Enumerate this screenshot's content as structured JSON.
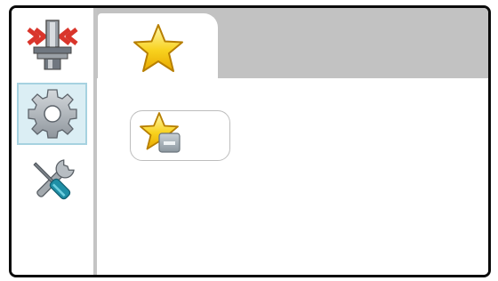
{
  "window": {
    "title": ""
  },
  "sidebar": {
    "items": [
      {
        "icon": "compress-tool-icon",
        "active": false
      },
      {
        "icon": "gear-icon",
        "active": true
      },
      {
        "icon": "tools-icon",
        "active": false
      }
    ]
  },
  "tabs": [
    {
      "icon": "star-icon",
      "selected": true
    }
  ],
  "content": {
    "buttons": [
      {
        "icon": "star-remove-icon"
      }
    ]
  },
  "colors": {
    "frame": "#0b0b0b",
    "tabbar": "#c2c2c2",
    "active_item_bg": "#dbeef4",
    "active_item_border": "#a6d2e0",
    "star_fill": "#f5c400"
  }
}
